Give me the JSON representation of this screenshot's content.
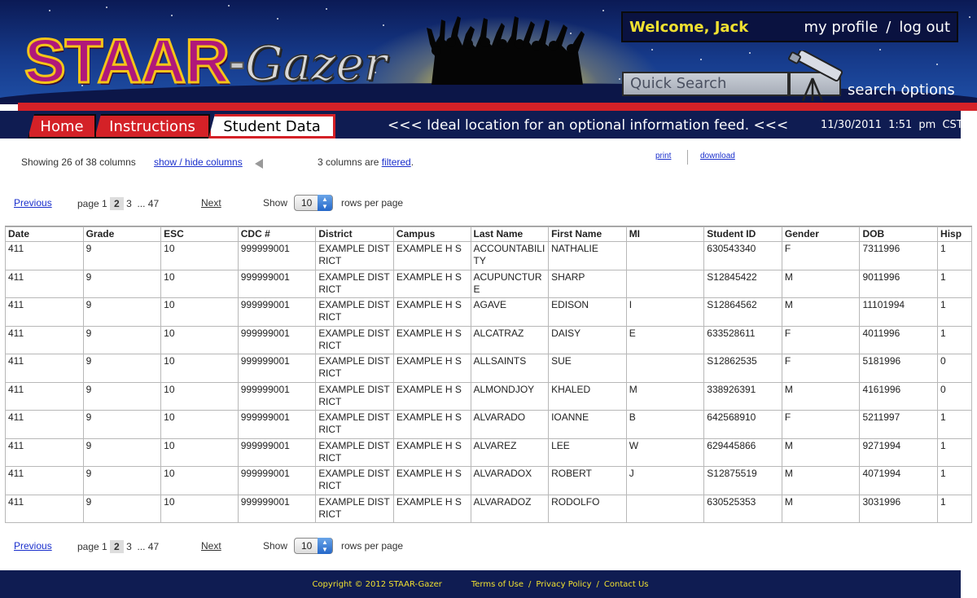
{
  "header": {
    "logo_staar": "STAAR",
    "logo_dash": "-",
    "logo_gazer": "Gazer",
    "welcome": "Welcome, Jack",
    "my_profile": "my profile",
    "separator": "/",
    "log_out": "log out",
    "search_placeholder": "Quick Search",
    "search_options": "search options"
  },
  "nav": {
    "tabs": [
      "Home",
      "Instructions",
      "Student Data"
    ],
    "active_tab": "Student Data",
    "feed": "<<< Ideal location for an optional information feed. <<<",
    "date": "11/30/2011",
    "time": "1:51 pm CST"
  },
  "controls": {
    "showing": "Showing 26 of 38 columns",
    "show_hide": "show / hide columns",
    "filtered_prefix": "3 columns are ",
    "filtered_link": "filtered",
    "filtered_suffix": ".",
    "print": "print",
    "download": "download"
  },
  "pager": {
    "previous": "Previous",
    "page_label": "page 1",
    "current": "2",
    "next_page": "3",
    "ellipsis": "...",
    "last": "47",
    "next": "Next",
    "show": "Show",
    "rows_value": "10",
    "rows_per_page": "rows per page"
  },
  "table": {
    "columns": [
      "Date",
      "Grade",
      "ESC",
      "CDC #",
      "District",
      "Campus",
      "Last Name",
      "First Name",
      "MI",
      "Student ID",
      "Gender",
      "DOB",
      "Hisp"
    ],
    "rows": [
      [
        "411",
        "9",
        "10",
        "999999001",
        "EXAMPLE DISTRICT",
        "EXAMPLE H S",
        "ACCOUNTABILITY",
        "NATHALIE",
        "",
        "630543340",
        "F",
        "7311996",
        "1"
      ],
      [
        "411",
        "9",
        "10",
        "999999001",
        "EXAMPLE DISTRICT",
        "EXAMPLE H S",
        "ACUPUNCTURE",
        "SHARP",
        "",
        "S12845422",
        "M",
        "9011996",
        "1"
      ],
      [
        "411",
        "9",
        "10",
        "999999001",
        "EXAMPLE DISTRICT",
        "EXAMPLE H S",
        "AGAVE",
        "EDISON",
        "I",
        "S12864562",
        "M",
        "11101994",
        "1"
      ],
      [
        "411",
        "9",
        "10",
        "999999001",
        "EXAMPLE DISTRICT",
        "EXAMPLE H S",
        "ALCATRAZ",
        "DAISY",
        "E",
        "633528611",
        "F",
        "4011996",
        "1"
      ],
      [
        "411",
        "9",
        "10",
        "999999001",
        "EXAMPLE DISTRICT",
        "EXAMPLE H S",
        "ALLSAINTS",
        "SUE",
        "",
        "S12862535",
        "F",
        "5181996",
        "0"
      ],
      [
        "411",
        "9",
        "10",
        "999999001",
        "EXAMPLE DISTRICT",
        "EXAMPLE H S",
        "ALMONDJOY",
        "KHALED",
        "M",
        "338926391",
        "M",
        "4161996",
        "0"
      ],
      [
        "411",
        "9",
        "10",
        "999999001",
        "EXAMPLE DISTRICT",
        "EXAMPLE H S",
        "ALVARADO",
        "IOANNE",
        "B",
        "642568910",
        "F",
        "5211997",
        "1"
      ],
      [
        "411",
        "9",
        "10",
        "999999001",
        "EXAMPLE DISTRICT",
        "EXAMPLE H S",
        "ALVAREZ",
        "LEE",
        "W",
        "629445866",
        "M",
        "9271994",
        "1"
      ],
      [
        "411",
        "9",
        "10",
        "999999001",
        "EXAMPLE DISTRICT",
        "EXAMPLE H S",
        "ALVARADOX",
        "ROBERT",
        "J",
        "S12875519",
        "M",
        "4071994",
        "1"
      ],
      [
        "411",
        "9",
        "10",
        "999999001",
        "EXAMPLE DISTRICT",
        "EXAMPLE H S",
        "ALVARADOZ",
        "RODOLFO",
        "",
        "630525353",
        "M",
        "3031996",
        "1"
      ]
    ]
  },
  "footer": {
    "copyright": "Copyright © 2012  STAAR-Gazer",
    "terms": "Terms of Use",
    "sep": "/",
    "privacy": "Privacy Policy",
    "contact": "Contact Us"
  },
  "icons": {
    "telescope": "telescope-icon",
    "arrow_left": "triangle-left-icon",
    "select_arrows": "updown-arrows-icon"
  },
  "colors": {
    "nav_blue": "#0f1c52",
    "accent_red": "#d42127",
    "welcome_yellow": "#f0e030",
    "link_blue": "#1a2fcc"
  }
}
